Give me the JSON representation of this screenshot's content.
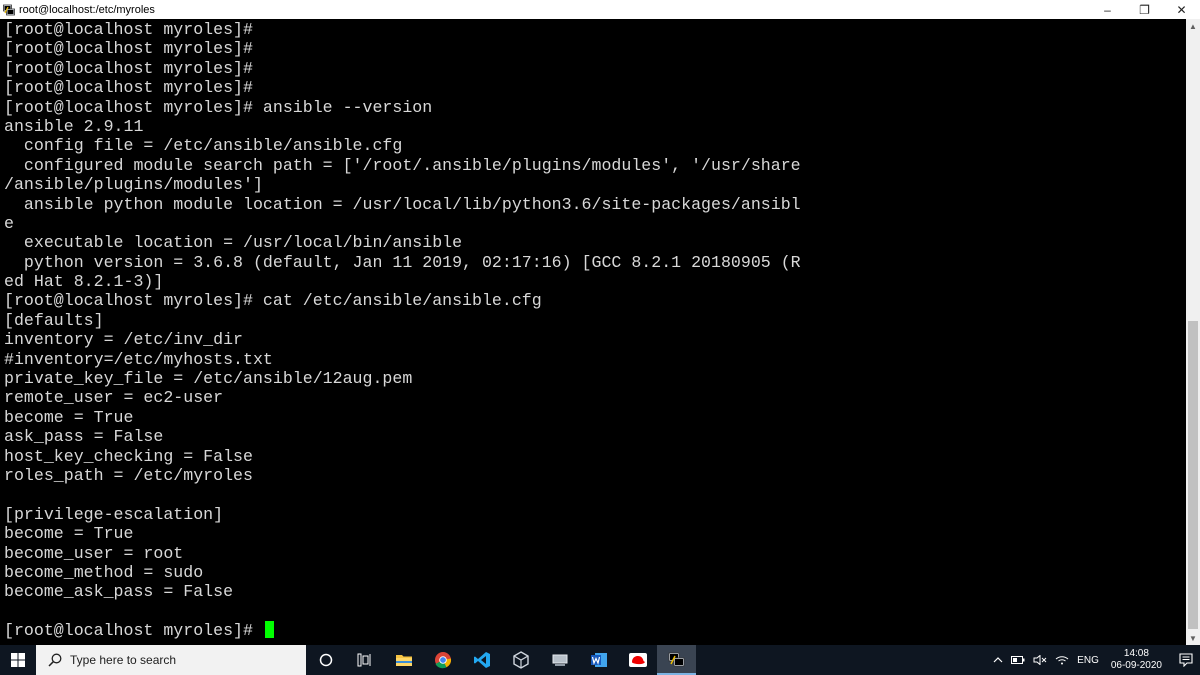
{
  "window": {
    "title": "root@localhost:/etc/myroles",
    "minimize_label": "–",
    "maximize_label": "❐",
    "close_label": "✕"
  },
  "terminal": {
    "lines": [
      "[root@localhost myroles]#",
      "[root@localhost myroles]#",
      "[root@localhost myroles]#",
      "[root@localhost myroles]#",
      "[root@localhost myroles]# ansible --version",
      "ansible 2.9.11",
      "  config file = /etc/ansible/ansible.cfg",
      "  configured module search path = ['/root/.ansible/plugins/modules', '/usr/share",
      "/ansible/plugins/modules']",
      "  ansible python module location = /usr/local/lib/python3.6/site-packages/ansibl",
      "e",
      "  executable location = /usr/local/bin/ansible",
      "  python version = 3.6.8 (default, Jan 11 2019, 02:17:16) [GCC 8.2.1 20180905 (R",
      "ed Hat 8.2.1-3)]",
      "[root@localhost myroles]# cat /etc/ansible/ansible.cfg",
      "[defaults]",
      "inventory = /etc/inv_dir",
      "#inventory=/etc/myhosts.txt",
      "private_key_file = /etc/ansible/12aug.pem",
      "remote_user = ec2-user",
      "become = True",
      "ask_pass = False",
      "host_key_checking = False",
      "roles_path = /etc/myroles",
      "",
      "[privilege-escalation]",
      "become = True",
      "become_user = root",
      "become_method = sudo",
      "become_ask_pass = False",
      ""
    ],
    "prompt": "[root@localhost myroles]# ",
    "cursor_color": "#00ff00"
  },
  "taskbar": {
    "search_placeholder": "Type here to search",
    "language": "ENG",
    "time": "14:08",
    "date": "06-09-2020"
  },
  "icons": {
    "start": "windows-start-icon",
    "search": "search-icon",
    "cortana": "cortana-circle-icon",
    "task_view": "task-view-icon",
    "file_explorer": "folder-icon",
    "chrome": "chrome-icon",
    "vscode": "vscode-icon",
    "virtualbox": "virtualbox-icon",
    "network_drive": "network-drive-icon",
    "word": "word-icon",
    "redhat": "redhat-icon",
    "putty": "putty-icon",
    "notifications": "notifications-icon"
  },
  "colors": {
    "terminal_bg": "#000000",
    "terminal_fg": "#d8d8d8",
    "taskbar_bg": "#0e1621"
  }
}
